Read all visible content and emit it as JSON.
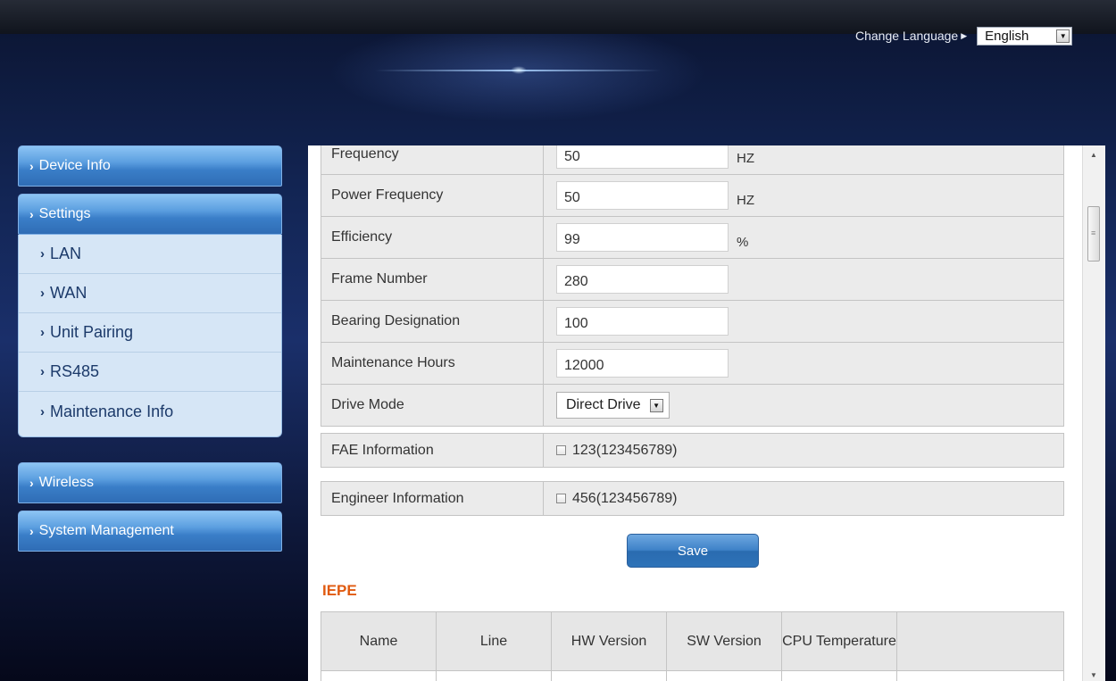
{
  "header": {
    "change_language_label": "Change Language",
    "language_selected": "English"
  },
  "sidebar": {
    "device_info": "Device Info",
    "settings": "Settings",
    "settings_items": [
      {
        "label": "LAN"
      },
      {
        "label": "WAN"
      },
      {
        "label": "Unit Pairing"
      },
      {
        "label": "RS485"
      },
      {
        "label": "Maintenance Info"
      }
    ],
    "wireless": "Wireless",
    "system_management": "System Management"
  },
  "form": {
    "rows": [
      {
        "label": "Frequency",
        "value": "50",
        "unit": "HZ"
      },
      {
        "label": "Power Frequency",
        "value": "50",
        "unit": "HZ"
      },
      {
        "label": "Efficiency",
        "value": "99",
        "unit": "%"
      },
      {
        "label": "Frame Number",
        "value": "280",
        "unit": ""
      },
      {
        "label": "Bearing Designation",
        "value": "100",
        "unit": ""
      },
      {
        "label": "Maintenance Hours",
        "value": "12000",
        "unit": ""
      }
    ],
    "drive_mode_label": "Drive Mode",
    "drive_mode_value": "Direct Drive",
    "fae_label": "FAE Information",
    "fae_value": "123(123456789)",
    "engineer_label": "Engineer Information",
    "engineer_value": "456(123456789)",
    "save_label": "Save"
  },
  "iepe": {
    "title": "IEPE",
    "columns": [
      "Name",
      "Line",
      "HW Version",
      "SW Version",
      "CPU Temperature",
      ""
    ]
  },
  "icons": {
    "chevron": "chevron-right-icon",
    "dropdown": "dropdown-arrow-icon",
    "checkbox": "checkbox-icon"
  }
}
